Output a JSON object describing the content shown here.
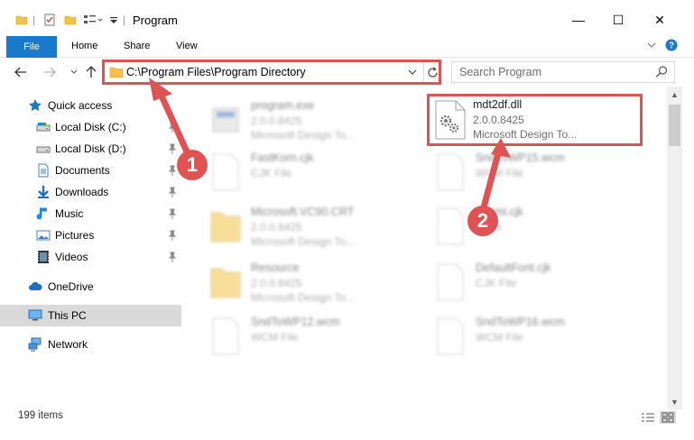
{
  "window": {
    "title": "Program",
    "minimize": "—",
    "maximize": "☐",
    "close": "✕"
  },
  "ribbon": {
    "tabs": [
      "File",
      "Home",
      "Share",
      "View"
    ],
    "expand_icon": "chevron-down-icon",
    "help": "?"
  },
  "navigation": {
    "address": "C:\\Program Files\\Program Directory",
    "search_placeholder": "Search Program"
  },
  "sidebar": {
    "items": [
      {
        "label": "Quick access",
        "icon": "star-icon",
        "pinned": false
      },
      {
        "label": "Local Disk (C:)",
        "icon": "drive-icon",
        "pinned": true
      },
      {
        "label": "Local Disk (D:)",
        "icon": "drive-icon",
        "pinned": true
      },
      {
        "label": "Documents",
        "icon": "documents-icon",
        "pinned": true
      },
      {
        "label": "Downloads",
        "icon": "downloads-icon",
        "pinned": true
      },
      {
        "label": "Music",
        "icon": "music-icon",
        "pinned": true
      },
      {
        "label": "Pictures",
        "icon": "pictures-icon",
        "pinned": true
      },
      {
        "label": "Videos",
        "icon": "videos-icon",
        "pinned": true
      },
      {
        "label": "OneDrive",
        "icon": "cloud-icon",
        "pinned": false
      },
      {
        "label": "This PC",
        "icon": "computer-icon",
        "pinned": false,
        "selected": true
      },
      {
        "label": "Network",
        "icon": "network-icon",
        "pinned": false
      }
    ]
  },
  "files": [
    {
      "name": "program.exe",
      "line1": "2.0.0.8425",
      "line2": "Microsoft Design To...",
      "icon": "exe-icon"
    },
    {
      "name": "mdt2df.dll",
      "line1": "2.0.0.8425",
      "line2": "Microsoft Design To...",
      "icon": "dll-icon",
      "highlighted": true
    },
    {
      "name": "FastKorn.cjk",
      "line1": "CJK File",
      "icon": "file-icon"
    },
    {
      "name": "SndToWP15.wcm",
      "line1": "WCM File",
      "icon": "file-icon"
    },
    {
      "name": "Microsoft.VC90.CRT",
      "line1": "2.0.0.8425",
      "line2": "Microsoft Design To...",
      "icon": "folder-icon"
    },
    {
      "name": "...html.cjk",
      "line1": "...File",
      "icon": "file-icon"
    },
    {
      "name": "Resource",
      "line1": "2.0.0.8425",
      "line2": "Microsoft Design To...",
      "icon": "folder-icon"
    },
    {
      "name": "DefaultFont.cjk",
      "line1": "CJK File",
      "icon": "file-icon"
    },
    {
      "name": "SndToWP12.wcm",
      "line1": "WCM File",
      "icon": "file-icon"
    },
    {
      "name": "SndToWP16.wcm",
      "line1": "WCM File",
      "icon": "file-icon"
    }
  ],
  "status": {
    "item_count": "199 items"
  },
  "annotations": {
    "step1": "1",
    "step2": "2",
    "color": "#e05353"
  }
}
